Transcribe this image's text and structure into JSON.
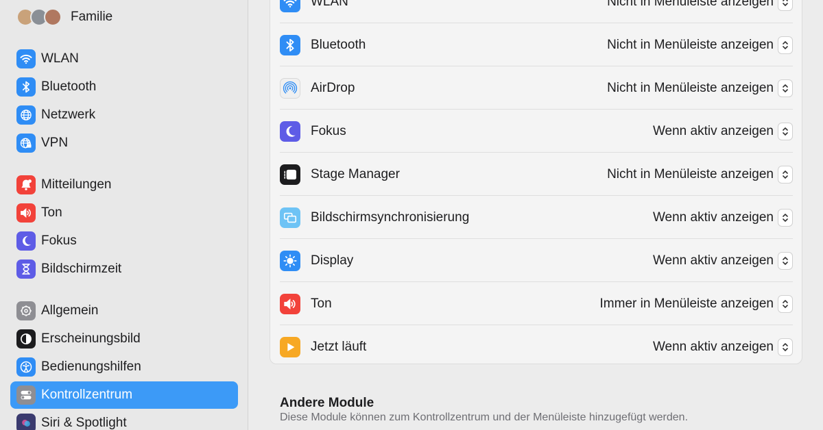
{
  "sidebar": {
    "family": {
      "label": "Familie"
    },
    "groups": [
      [
        {
          "label": "WLAN",
          "icon": "wifi-icon",
          "color": "#2f8df5"
        },
        {
          "label": "Bluetooth",
          "icon": "bluetooth-icon",
          "color": "#2f8df5"
        },
        {
          "label": "Netzwerk",
          "icon": "globe-icon",
          "color": "#2f8df5"
        },
        {
          "label": "VPN",
          "icon": "vpn-globe-icon",
          "color": "#2f8df5"
        }
      ],
      [
        {
          "label": "Mitteilungen",
          "icon": "bell-icon",
          "color": "#f2423a"
        },
        {
          "label": "Ton",
          "icon": "speaker-icon",
          "color": "#f2423a"
        },
        {
          "label": "Fokus",
          "icon": "moon-icon",
          "color": "#5e5ce6"
        },
        {
          "label": "Bildschirmzeit",
          "icon": "hourglass-icon",
          "color": "#5e5ce6"
        }
      ],
      [
        {
          "label": "Allgemein",
          "icon": "gear-icon",
          "color": "#8e8e93"
        },
        {
          "label": "Erscheinungsbild",
          "icon": "appearance-icon",
          "color": "#1c1c1e"
        },
        {
          "label": "Bedienungshilfen",
          "icon": "accessibility-icon",
          "color": "#2f8df5"
        },
        {
          "label": "Kontrollzentrum",
          "icon": "toggles-icon",
          "color": "#8e8e93",
          "selected": true
        },
        {
          "label": "Siri & Spotlight",
          "icon": "siri-icon",
          "color": "#3a3a6e"
        }
      ]
    ]
  },
  "main": {
    "rows": [
      {
        "label": "WLAN",
        "value": "Nicht in Menüleiste anzeigen",
        "icon": "wifi-icon",
        "color": "#2f8df5"
      },
      {
        "label": "Bluetooth",
        "value": "Nicht in Menüleiste anzeigen",
        "icon": "bluetooth-icon",
        "color": "#2f8df5"
      },
      {
        "label": "AirDrop",
        "value": "Nicht in Menüleiste anzeigen",
        "icon": "airdrop-icon",
        "color": "#f0f0f0"
      },
      {
        "label": "Fokus",
        "value": "Wenn aktiv anzeigen",
        "icon": "moon-icon",
        "color": "#5e5ce6"
      },
      {
        "label": "Stage Manager",
        "value": "Nicht in Menüleiste anzeigen",
        "icon": "stage-manager-icon",
        "color": "#1c1c1e"
      },
      {
        "label": "Bildschirmsynchronisierung",
        "value": "Wenn aktiv anzeigen",
        "icon": "screen-mirroring-icon",
        "color": "#6ec3f5"
      },
      {
        "label": "Display",
        "value": "Wenn aktiv anzeigen",
        "icon": "sun-icon",
        "color": "#2f8df5"
      },
      {
        "label": "Ton",
        "value": "Immer in Menüleiste anzeigen",
        "icon": "speaker-icon",
        "color": "#f2423a"
      },
      {
        "label": "Jetzt läuft",
        "value": "Wenn aktiv anzeigen",
        "icon": "play-icon",
        "color": "#f7a824"
      }
    ],
    "other": {
      "title": "Andere Module",
      "subtitle": "Diese Module können zum Kontrollzentrum und der Menüleiste hinzugefügt werden."
    }
  }
}
